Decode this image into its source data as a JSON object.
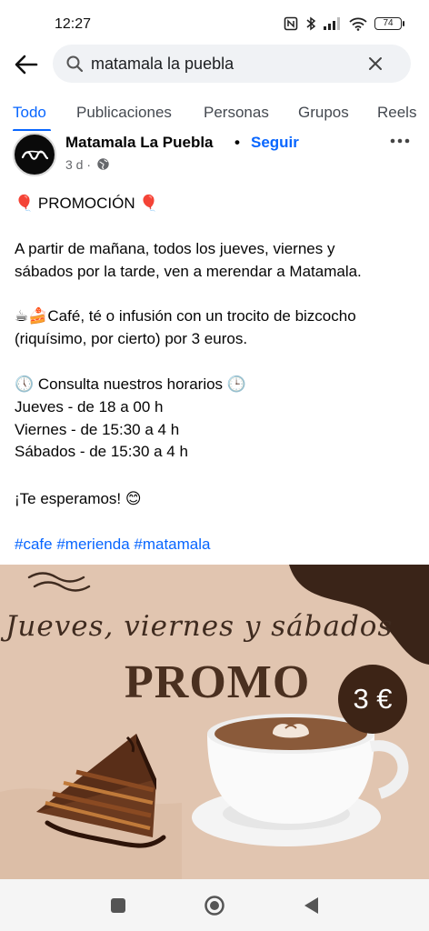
{
  "status_bar": {
    "time": "12:27",
    "battery": "74"
  },
  "search": {
    "query": "matamala la puebla"
  },
  "tabs": [
    {
      "label": "Todo"
    },
    {
      "label": "Publicaciones"
    },
    {
      "label": "Personas"
    },
    {
      "label": "Grupos"
    },
    {
      "label": "Reels"
    }
  ],
  "post": {
    "page_name": "Matamala La Puebla",
    "separator": "•",
    "follow_label": "Seguir",
    "time": "3 d ·",
    "lines": [
      "🎈 PROMOCIÓN 🎈",
      "A partir de mañana, todos los jueves, viernes y",
      "sábados por la tarde, ven a merendar a Matamala.",
      "☕🍰Café, té o infusión con un trocito de bizcocho",
      "(riquísimo, por cierto) por 3 euros.",
      "🕔 Consulta nuestros horarios 🕒",
      "Jueves - de 18 a 00 h",
      "Viernes - de 15:30 a 4 h",
      "Sábados - de 15:30 a 4 h",
      "¡Te esperamos! 😊"
    ],
    "hashtags": [
      "#cafe",
      "#merienda",
      "#matamala"
    ]
  },
  "promo_image": {
    "subtitle": "Jueves, viernes y sábados",
    "title": "PROMO",
    "price": "3 €"
  },
  "colors": {
    "accent": "#0866ff",
    "promo_bg": "#e1c5b0",
    "promo_dark": "#3d2416"
  }
}
